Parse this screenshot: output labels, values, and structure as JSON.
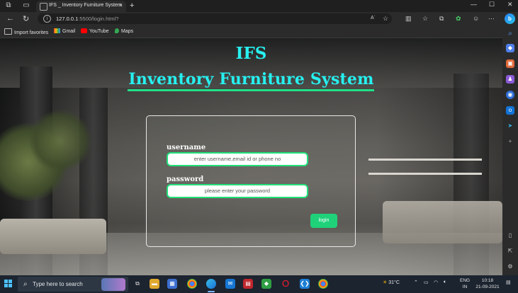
{
  "browser": {
    "tab_title": "IFS _ Inventory Furniture System",
    "tab_close": "×",
    "new_tab": "+",
    "url_host": "127.0.0.1",
    "url_rest": ":5500/login.html?",
    "read_aloud": "Aʾ"
  },
  "bookmarks": [
    {
      "label": "Import favorites"
    },
    {
      "label": "Gmail"
    },
    {
      "label": "YouTube"
    },
    {
      "label": "Maps"
    }
  ],
  "page": {
    "logo_title": "IFS",
    "system_name": "Inventory Furniture System",
    "username_label": "username",
    "username_placeholder": "enter username,email id or phone no",
    "password_label": "password",
    "password_placeholder": "please enter your password",
    "login_button": "login"
  },
  "taskbar": {
    "search_placeholder": "Type here to search",
    "weather": "31°C",
    "lang_line1": "ENG",
    "lang_line2": "IN",
    "time": "10:18",
    "date": "21-09-2021"
  },
  "colors": {
    "accent_cyan": "#27f0f0",
    "accent_green": "#20e08a"
  }
}
